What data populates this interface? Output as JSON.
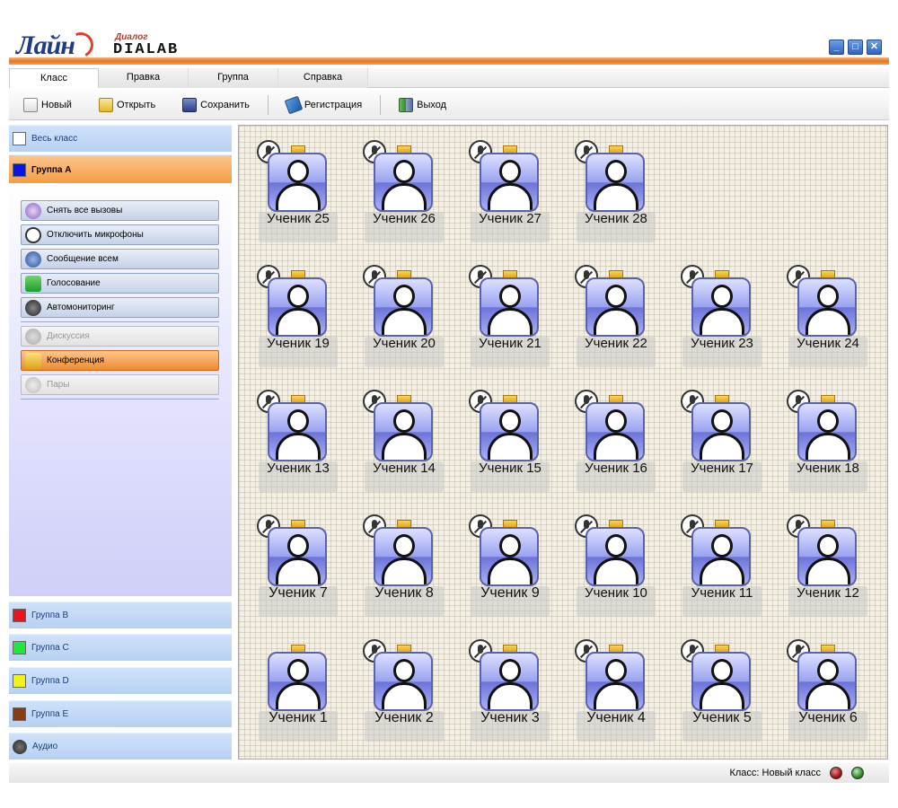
{
  "app": {
    "logo_main": "Лайн",
    "logo_sub": "Диалог",
    "logo_dialab": "DIALAB"
  },
  "window_buttons": [
    "_",
    "□",
    "✕"
  ],
  "tabs": [
    {
      "label": "Класс",
      "active": true
    },
    {
      "label": "Правка",
      "active": false
    },
    {
      "label": "Группа",
      "active": false
    },
    {
      "label": "Справка",
      "active": false
    }
  ],
  "toolbar": {
    "new_label": "Новый",
    "open_label": "Открыть",
    "save_label": "Сохранить",
    "register_label": "Регистрация",
    "exit_label": "Выход"
  },
  "sidebar": {
    "whole_class": "Весь класс",
    "active_group": "Группа А",
    "actions": [
      {
        "label": "Снять все вызовы",
        "state": "normal",
        "icon": "help-icon"
      },
      {
        "label": "Отключить микрофоны",
        "state": "normal",
        "icon": "mic-off-icon"
      },
      {
        "label": "Сообщение всем",
        "state": "normal",
        "icon": "message-icon"
      },
      {
        "label": "Голосование",
        "state": "normal",
        "icon": "vote-icon"
      },
      {
        "label": "Автомониторинг",
        "state": "normal",
        "icon": "headset-icon"
      },
      {
        "label": "Дискуссия",
        "state": "disabled",
        "icon": "discussion-icon"
      },
      {
        "label": "Конференция",
        "state": "active",
        "icon": "conference-icon"
      },
      {
        "label": "Пары",
        "state": "disabled",
        "icon": "pairs-icon"
      }
    ],
    "groups": [
      {
        "label": "Группа B",
        "color": "#e8141e"
      },
      {
        "label": "Группа C",
        "color": "#1ee83c"
      },
      {
        "label": "Группа D",
        "color": "#f2f21a"
      },
      {
        "label": "Группа E",
        "color": "#8a3b10"
      }
    ],
    "audio_label": "Аудио",
    "whole_class_color": "#ffffff",
    "active_group_color": "#0a14e6"
  },
  "students": [
    {
      "name": "Ученик 25",
      "mic": true
    },
    {
      "name": "Ученик 26",
      "mic": true
    },
    {
      "name": "Ученик 27",
      "mic": true
    },
    {
      "name": "Ученик 28",
      "mic": true
    },
    {
      "name": "Ученик 19",
      "mic": true
    },
    {
      "name": "Ученик 20",
      "mic": true
    },
    {
      "name": "Ученик 21",
      "mic": true
    },
    {
      "name": "Ученик 22",
      "mic": true
    },
    {
      "name": "Ученик 23",
      "mic": true
    },
    {
      "name": "Ученик 24",
      "mic": true
    },
    {
      "name": "Ученик 13",
      "mic": true
    },
    {
      "name": "Ученик 14",
      "mic": true
    },
    {
      "name": "Ученик 15",
      "mic": true
    },
    {
      "name": "Ученик 16",
      "mic": true
    },
    {
      "name": "Ученик 17",
      "mic": true
    },
    {
      "name": "Ученик 18",
      "mic": true
    },
    {
      "name": "Ученик 7",
      "mic": true
    },
    {
      "name": "Ученик 8",
      "mic": true
    },
    {
      "name": "Ученик 9",
      "mic": true
    },
    {
      "name": "Ученик 10",
      "mic": true
    },
    {
      "name": "Ученик 11",
      "mic": true
    },
    {
      "name": "Ученик 12",
      "mic": true
    },
    {
      "name": "Ученик 1",
      "mic": false
    },
    {
      "name": "Ученик 2",
      "mic": true
    },
    {
      "name": "Ученик 3",
      "mic": true
    },
    {
      "name": "Ученик 4",
      "mic": true
    },
    {
      "name": "Ученик 5",
      "mic": true
    },
    {
      "name": "Ученик 6",
      "mic": true
    }
  ],
  "status": {
    "class_label": "Класс: Новый класс",
    "led1_color": "#a01818",
    "led2_color": "#2e8a2e"
  }
}
